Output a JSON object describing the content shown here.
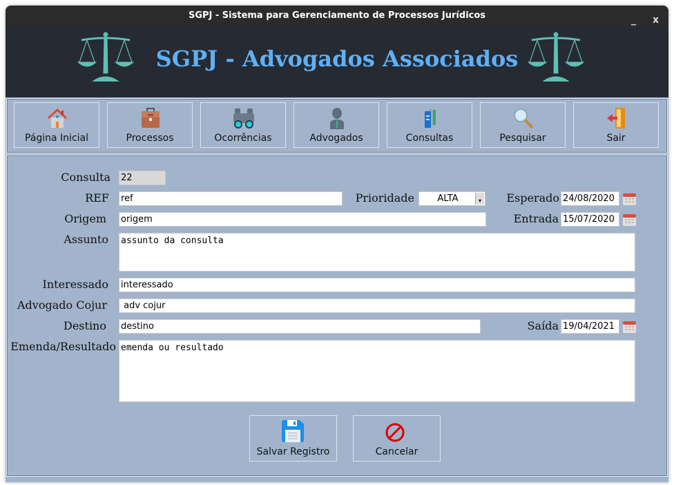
{
  "window": {
    "title": "SGPJ - Sistema para Gerenciamento de Processos Jurídicos",
    "minimize": "_",
    "close": "x"
  },
  "header": {
    "title": "SGPJ - Advogados Associados"
  },
  "toolbar": [
    {
      "label": "Página Inicial",
      "icon": "home-icon"
    },
    {
      "label": "Processos",
      "icon": "briefcase-icon"
    },
    {
      "label": "Ocorrências",
      "icon": "binoculars-icon"
    },
    {
      "label": "Advogados",
      "icon": "lawyer-icon"
    },
    {
      "label": "Consultas",
      "icon": "books-icon"
    },
    {
      "label": "Pesquisar",
      "icon": "magnifier-icon"
    },
    {
      "label": "Sair",
      "icon": "exit-door-icon"
    }
  ],
  "form": {
    "consulta": {
      "label": "Consulta",
      "value": "22"
    },
    "ref": {
      "label": "REF",
      "value": "ref"
    },
    "prioridade": {
      "label": "Prioridade",
      "value": "ALTA"
    },
    "esperado": {
      "label": "Esperado",
      "value": "24/08/2020"
    },
    "origem": {
      "label": "Origem",
      "value": "origem"
    },
    "entrada": {
      "label": "Entrada",
      "value": "15/07/2020"
    },
    "assunto": {
      "label": "Assunto",
      "value": "assunto da consulta"
    },
    "interessado": {
      "label": "Interessado",
      "value": "interessado"
    },
    "advogado": {
      "label": "Advogado Cojur",
      "value": " adv cojur"
    },
    "destino": {
      "label": "Destino",
      "value": "destino"
    },
    "saida": {
      "label": "Saída",
      "value": "19/04/2021"
    },
    "emenda": {
      "label": "Emenda/Resultado",
      "value": "emenda ou resultado"
    }
  },
  "actions": {
    "save": "Salvar Registro",
    "cancel": "Cancelar"
  }
}
